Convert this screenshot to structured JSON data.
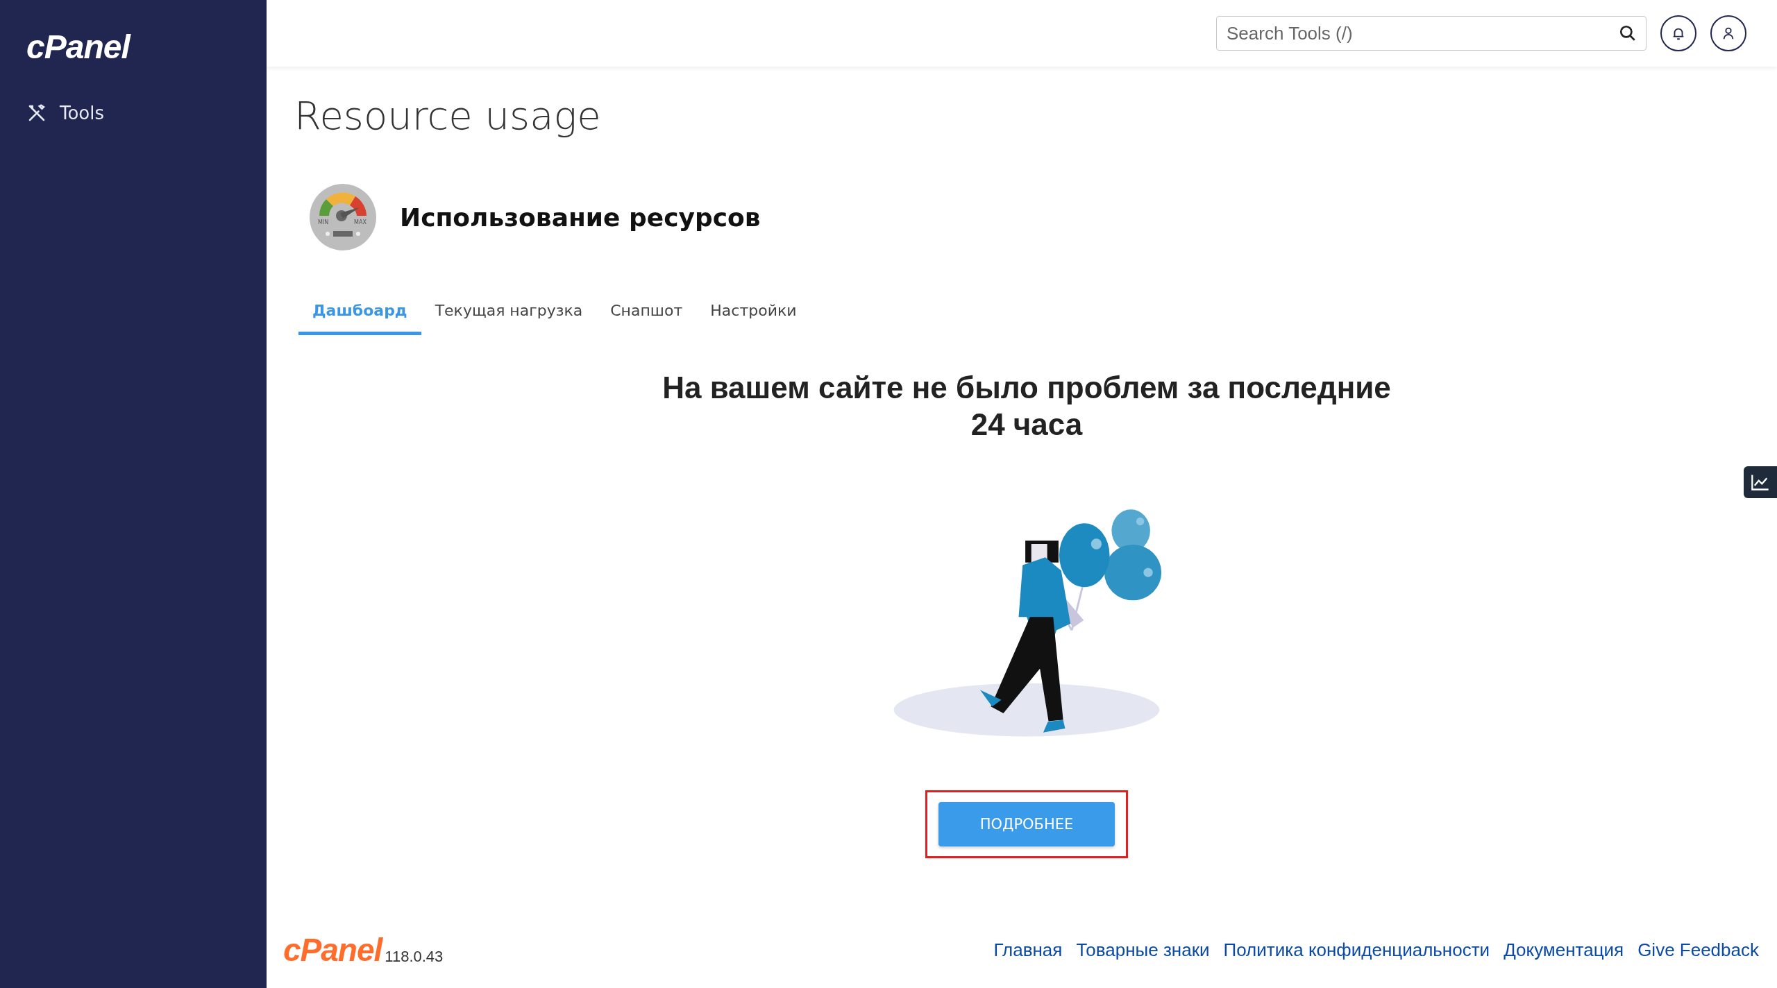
{
  "sidebar": {
    "logo": "cPanel",
    "items": [
      {
        "label": "Tools",
        "selected": false
      }
    ]
  },
  "header": {
    "search": {
      "placeholder": "Search Tools (/)"
    }
  },
  "page": {
    "title": "Resource usage"
  },
  "app": {
    "gauge_labels": [
      "MIN",
      "MAX"
    ],
    "title": "Использование ресурсов"
  },
  "tabs": [
    {
      "label": "Дашбоард",
      "selected": true
    },
    {
      "label": "Текущая нагрузка",
      "selected": false
    },
    {
      "label": "Снапшот",
      "selected": false
    },
    {
      "label": "Настройки",
      "selected": false
    }
  ],
  "message": "На вашем сайте не было проблем за последние 24 часа",
  "details_button": {
    "label": "ПОДРОБНЕЕ",
    "highlighted": true
  },
  "footer": {
    "logo": "cPanel",
    "version": "118.0.43",
    "links": [
      "Главная",
      "Товарные знаки",
      "Политика конфиденциальности",
      "Документация",
      "Give Feedback"
    ]
  }
}
